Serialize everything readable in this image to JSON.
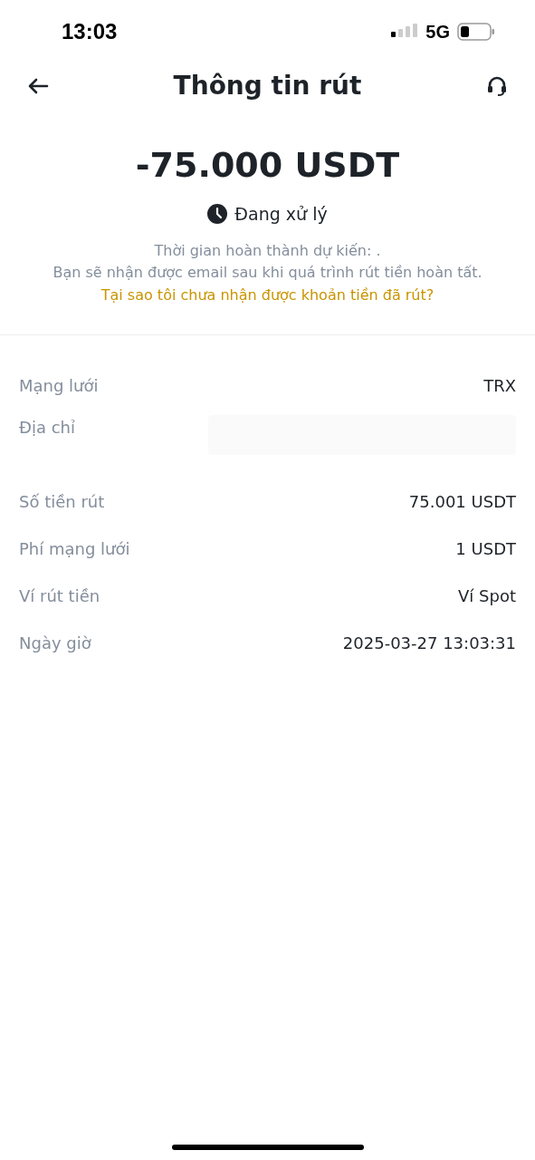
{
  "status_bar": {
    "time": "13:03",
    "network": "5G"
  },
  "header": {
    "title": "Thông tin rút"
  },
  "amount": "-75.000 USDT",
  "status": {
    "label": "Đang xử lý"
  },
  "notes": [
    "Thời gian hoàn thành dự kiến: .",
    "Bạn sẽ nhận được email sau khi quá trình rút tiền hoàn tất."
  ],
  "help_link": "Tại sao tôi chưa nhận được khoản tiền đã rút?",
  "details": [
    {
      "label": "Mạng lưới",
      "value": "TRX"
    },
    {
      "label": "Địa chỉ",
      "kind": "redacted"
    },
    {
      "label": "Số tiền rút",
      "value": "75.001 USDT"
    },
    {
      "label": "Phí mạng lưới",
      "value": "1 USDT"
    },
    {
      "label": "Ví rút tiền",
      "value": "Ví Spot"
    },
    {
      "label": "Ngày giờ",
      "value": "2025-03-27 13:03:31"
    }
  ]
}
